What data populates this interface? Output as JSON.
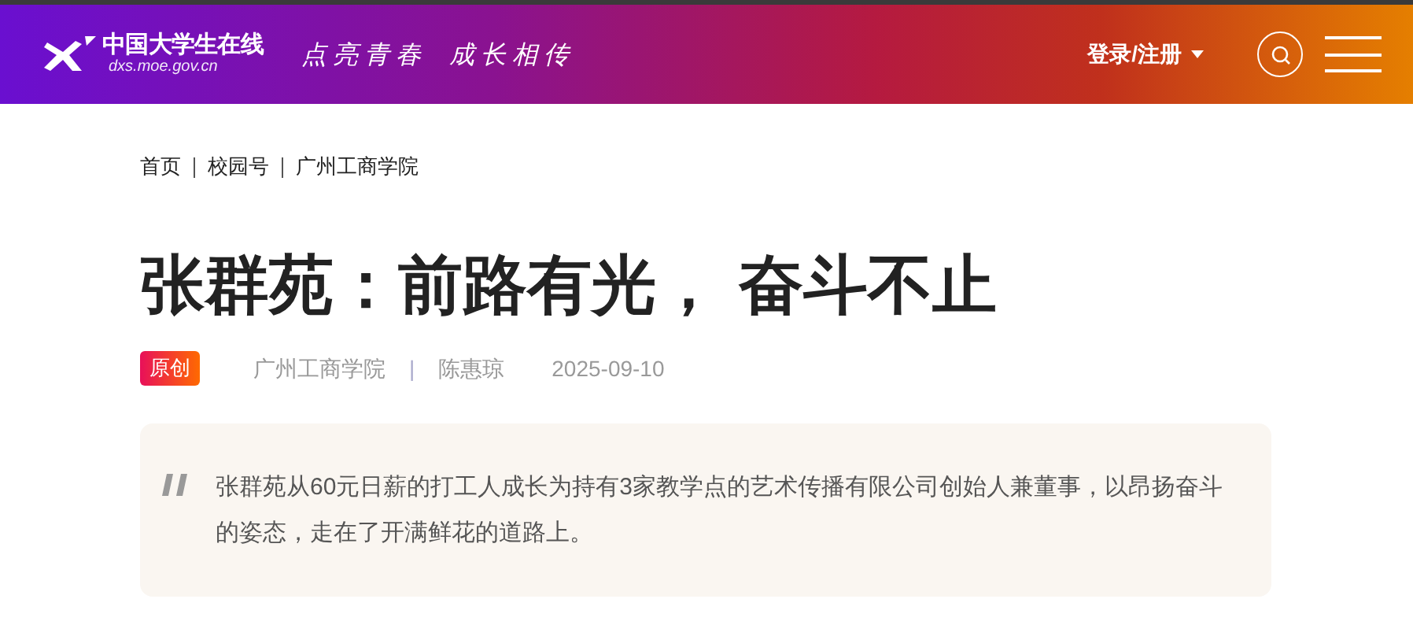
{
  "header": {
    "logo_title": "中国大学生在线",
    "logo_url": "dxs.moe.gov.cn",
    "slogan": [
      "点亮青春",
      "成长相传"
    ],
    "login": "登录/注册"
  },
  "breadcrumb": [
    "首页",
    "校园号",
    "广州工商学院"
  ],
  "article": {
    "title": "张群苑：前路有光， 奋斗不止",
    "badge": "原创",
    "source": "广州工商学院",
    "separator": "|",
    "author": "陈惠琼",
    "date": "2025-09-10",
    "summary": "张群苑从60元日薪的打工人成长为持有3家教学点的艺术传播有限公司创始人兼董事，以昂扬奋斗的姿态，走在了开满鲜花的道路上。"
  }
}
